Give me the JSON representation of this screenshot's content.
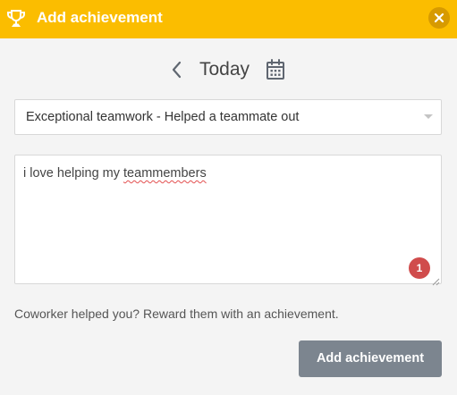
{
  "header": {
    "title": "Add achievement",
    "icon": "trophy-icon",
    "close_icon": "close-icon"
  },
  "date_nav": {
    "back_icon": "chevron-left-icon",
    "label": "Today",
    "calendar_icon": "calendar-icon"
  },
  "achievement_select": {
    "selected": "Exceptional teamwork - Helped a teammate out"
  },
  "message": {
    "text_before": "i love helping my ",
    "misspelled_word": "teammembers",
    "spelling_errors_count": "1"
  },
  "hint": "Coworker helped you? Reward them with an achievement.",
  "submit_label": "Add achievement",
  "colors": {
    "header_bg": "#fbbd00",
    "button_bg": "#7c858f",
    "error_badge": "#d04c4c"
  }
}
